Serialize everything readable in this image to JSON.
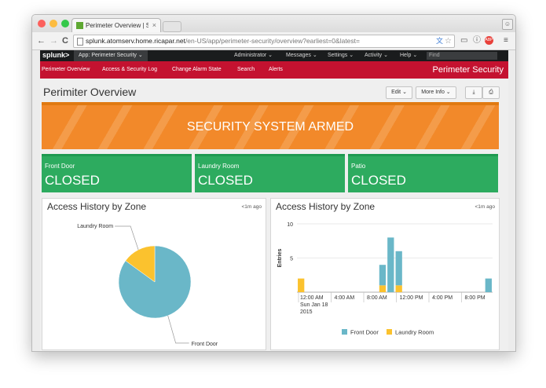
{
  "browser": {
    "tab_title": "Perimeter Overview | Splunk",
    "tab_close": "×",
    "url_host": "splunk.atomserv.home.ricapar.net",
    "url_path": "/en-US/app/perimeter-security/overview?earliest=0&latest=",
    "nav_back": "←",
    "nav_forward": "→",
    "nav_reload": "C",
    "colors": {
      "close": "#fc605c",
      "minimize": "#fdbc40",
      "zoom": "#34c84a"
    }
  },
  "splunk_bar": {
    "logo": "splunk>",
    "app_menu": "App: Perimeter Security ⌄",
    "items": [
      "Administrator ⌄",
      "Messages ⌄",
      "Settings ⌄",
      "Activity ⌄",
      "Help ⌄"
    ],
    "find_placeholder": "Find"
  },
  "app_bar": {
    "items": [
      "Perimeter Overview",
      "Access & Security Log",
      "Change Alarm State",
      "Search",
      "Alerts"
    ],
    "app_title": "Perimeter Security",
    "accent": "#c41230"
  },
  "dashboard": {
    "title": "Perimiter Overview",
    "edit_button": "Edit ⌄",
    "more_info_button": "More Info ⌄",
    "banner_text": "SECURITY SYSTEM ARMED",
    "status_boxes": [
      {
        "label": "Front Door",
        "value": "CLOSED"
      },
      {
        "label": "Laundry Room",
        "value": "CLOSED"
      },
      {
        "label": "Patio",
        "value": "CLOSED"
      }
    ],
    "colors": {
      "banner": "#f2892a",
      "status": "#2dab5f"
    }
  },
  "panels": {
    "pie_title": "Access History by Zone",
    "pie_ago": "<1m ago",
    "bar_title": "Access History by Zone",
    "bar_ago": "<1m ago"
  },
  "chart_data": [
    {
      "type": "pie",
      "title": "Access History by Zone",
      "labels": [
        "Front Door",
        "Laundry Room"
      ],
      "values": [
        85,
        15
      ],
      "colors": [
        "#6ab7c8",
        "#fbc22e"
      ]
    },
    {
      "type": "bar",
      "stacked": true,
      "title": "Access History by Zone",
      "ylabel": "Entries",
      "ylim": [
        0,
        10
      ],
      "yticks": [
        5,
        10
      ],
      "x_tick_labels": [
        "12:00 AM\nSun Jan 18\n2015",
        "4:00 AM",
        "8:00 AM",
        "12:00 PM",
        "4:00 PM",
        "8:00 PM"
      ],
      "x": [
        "00:00",
        "01:00",
        "02:00",
        "03:00",
        "04:00",
        "05:00",
        "06:00",
        "07:00",
        "08:00",
        "09:00",
        "10:00",
        "11:00",
        "12:00",
        "13:00",
        "14:00",
        "15:00",
        "16:00",
        "17:00",
        "18:00",
        "19:00",
        "20:00",
        "21:00",
        "22:00",
        "23:00"
      ],
      "series": [
        {
          "name": "Front Door",
          "color": "#6ab7c8",
          "values": [
            0,
            0,
            0,
            0,
            0,
            0,
            0,
            0,
            0,
            0,
            3,
            8,
            5,
            0,
            0,
            0,
            0,
            0,
            0,
            0,
            0,
            0,
            0,
            2
          ]
        },
        {
          "name": "Laundry Room",
          "color": "#fbc22e",
          "values": [
            2,
            0,
            0,
            0,
            0,
            0,
            0,
            0,
            0,
            0,
            1,
            0,
            1,
            0,
            0,
            0,
            0,
            0,
            0,
            0,
            0,
            0,
            0,
            0
          ]
        }
      ],
      "legend": "bottom"
    }
  ]
}
